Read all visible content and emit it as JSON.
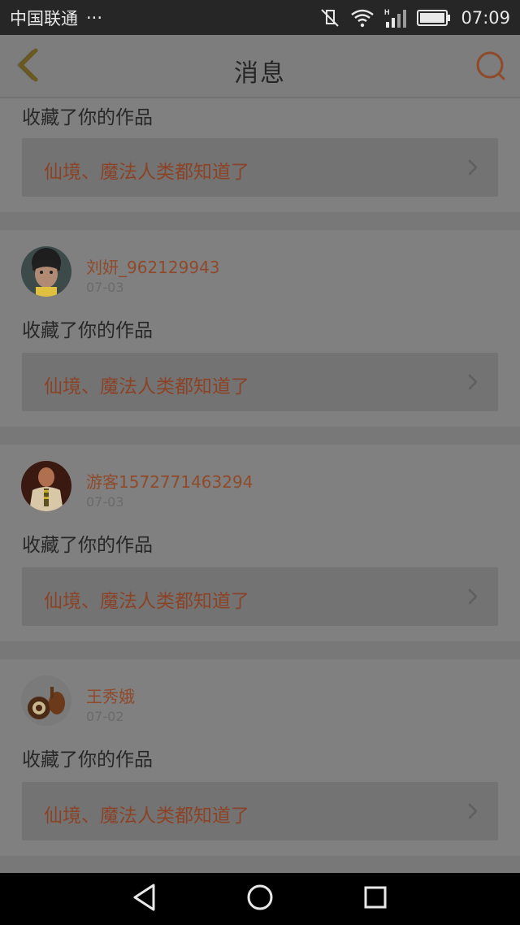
{
  "status_bar": {
    "carrier": "中国联通",
    "dots": "···",
    "time": "07:09",
    "icons": [
      "mute-icon",
      "wifi-icon",
      "signal-icon",
      "battery-icon"
    ]
  },
  "header": {
    "title": "消息",
    "back_icon": "chevron-left-icon",
    "search_icon": "search-icon"
  },
  "messages": [
    {
      "username": "",
      "date": "",
      "action": "收藏了你的作品",
      "work_title": "仙境、魔法人类都知道了"
    },
    {
      "username": "刘妍_962129943",
      "date": "07-03",
      "action": "收藏了你的作品",
      "work_title": "仙境、魔法人类都知道了"
    },
    {
      "username": "游客1572771463294",
      "date": "07-03",
      "action": "收藏了你的作品",
      "work_title": "仙境、魔法人类都知道了"
    },
    {
      "username": "王秀娥",
      "date": "07-02",
      "action": "收藏了你的作品",
      "work_title": "仙境、魔法人类都知道了"
    }
  ],
  "nav_bar": {
    "icons": [
      "back-triangle-icon",
      "home-circle-icon",
      "recents-square-icon"
    ]
  },
  "colors": {
    "accent": "#8e4a2b",
    "header_icon_back": "#6b5a20",
    "header_icon_search": "#8e4a2b"
  }
}
